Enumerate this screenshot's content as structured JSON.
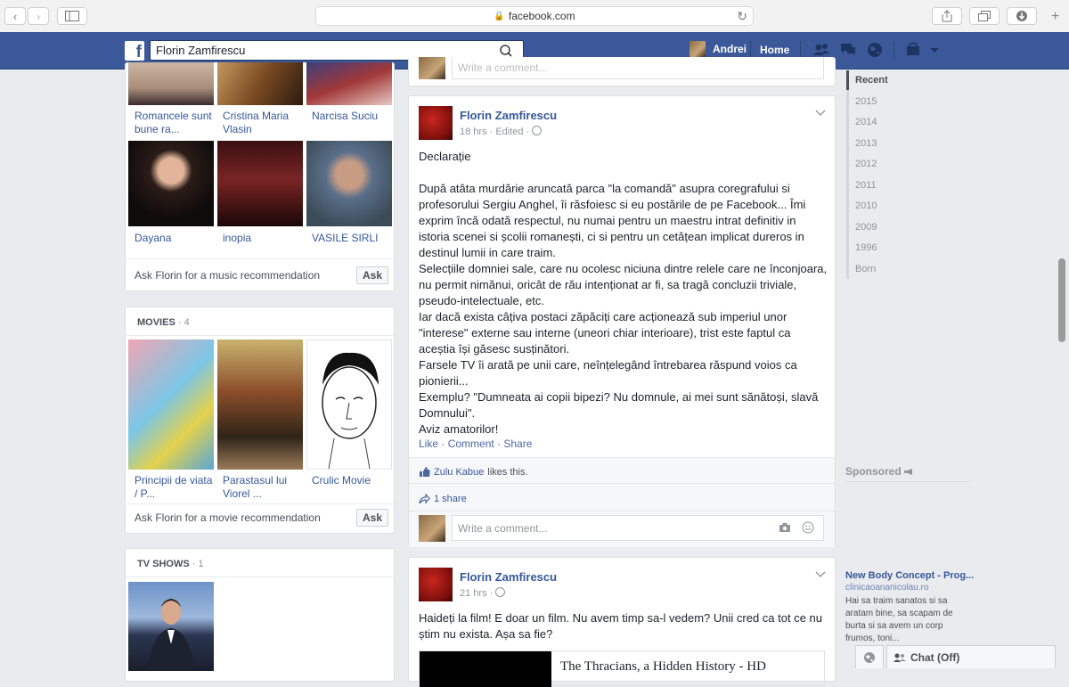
{
  "browser": {
    "url": "facebook.com"
  },
  "topbar": {
    "logo": "f",
    "search_value": "Florin Zamfirescu",
    "user_name": "Andrei",
    "home_label": "Home"
  },
  "music": {
    "items": [
      {
        "label": "Romancele sunt bune ra..."
      },
      {
        "label": "Cristina Maria Vlasin"
      },
      {
        "label": "Narcisa Suciu"
      },
      {
        "label": "Dayana"
      },
      {
        "label": "inopia"
      },
      {
        "label": "VASILE SIRLI"
      }
    ],
    "ask_text": "Ask Florin for a music recommendation",
    "ask_label": "Ask"
  },
  "movies": {
    "title": "MOVIES",
    "count": "· 4",
    "items": [
      {
        "label": "Principii de viata / P..."
      },
      {
        "label": "Parastasul lui Viorel ..."
      },
      {
        "label": "Crulic Movie"
      }
    ],
    "ask_text": "Ask Florin for a movie recommendation",
    "ask_label": "Ask"
  },
  "tvshows": {
    "title": "TV SHOWS",
    "count": "· 1"
  },
  "prev_post": {
    "comment_placeholder": "Write a comment..."
  },
  "post1": {
    "author": "Florin Zamfirescu",
    "meta": "18 hrs · Edited ·",
    "text": "Declarație\n\nDupă atâta murdărie aruncată parca \"la comandă\" asupra coregrafului si profesorului Sergiu Anghel, îi răsfoiesc si eu postările de pe Facebook... Îmi exprim încă odată respectul, nu numai pentru un maestru intrat definitiv in istoria scenei si școlii romanești, ci si pentru un cetățean implicat dureros in destinul lumii in care traim.\nSelecțiile domniei sale, care nu ocolesc niciuna dintre relele care ne înconjoara, nu permit nimănui, oricât de rău intenționat ar fi, sa tragă concluzii triviale, pseudo-intelectuale, etc.\nIar dacă exista câțiva postaci zăpăciți care acționează sub imperiul unor \"interese\" externe sau interne (uneori chiar interioare), trist este faptul ca aceștia își găsesc susținători.\nFarsele TV îi arată pe unii care, neînțelegând întrebarea răspund voios ca pionierii...\nExemplu? \"Dumneata ai copii bipezi? Nu domnule, ai mei sunt sănătoși, slavă Domnului\".\nAviz amatorilor!",
    "like": "Like",
    "comment": "Comment",
    "share": "Share",
    "liker": "Zulu Kabue",
    "likes_suffix": "likes this.",
    "shares": "1 share",
    "comment_placeholder": "Write a comment..."
  },
  "post2": {
    "author": "Florin Zamfirescu",
    "meta": "21 hrs ·",
    "text": "Haideți la film! E doar un film. Nu avem timp sa-l vedem? Unii cred ca tot ce nu știm nu exista. Așa sa fie?",
    "link_title": "The Thracians, a Hidden History - HD"
  },
  "timeline": {
    "years": [
      "Recent",
      "2015",
      "2014",
      "2013",
      "2012",
      "2011",
      "2010",
      "2009",
      "1996",
      "Born"
    ]
  },
  "sponsored": {
    "title": "Sponsored",
    "ad_title": "New Body Concept - Prog...",
    "ad_domain": "clinicaoananicolau.ro",
    "ad_text": "Hai sa traim sanatos si sa aratam bine, sa scapam de burta si sa avem un corp frumos, toni..."
  },
  "chat": {
    "label": "Chat (Off)"
  }
}
